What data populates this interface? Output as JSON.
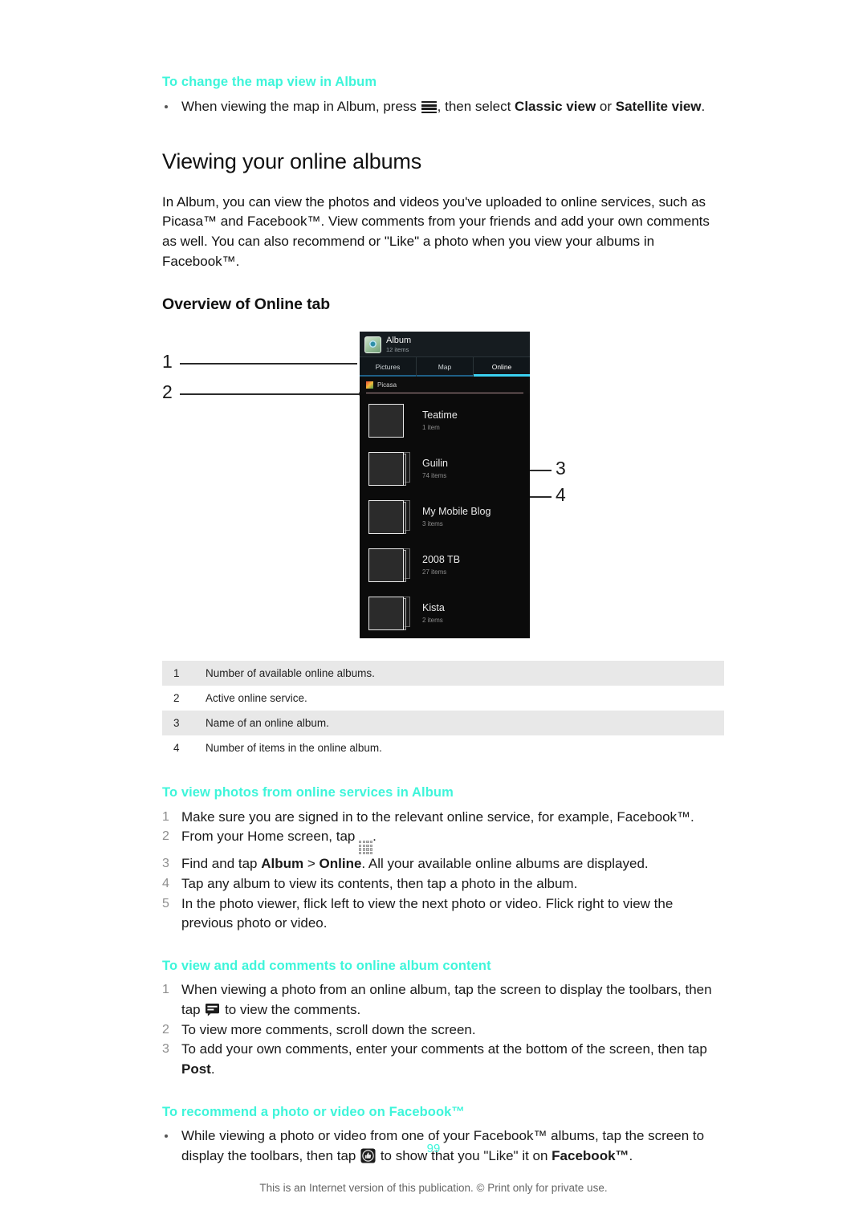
{
  "sections": {
    "change_map_view": {
      "heading": "To change the map view in Album",
      "bullet_pre": "When viewing the map in Album, press ",
      "bullet_mid": ", then select ",
      "bullet_bold1": "Classic view",
      "bullet_or": " or ",
      "bullet_bold2": "Satellite view",
      "bullet_end": "."
    },
    "viewing_online_albums": {
      "title": "Viewing your online albums",
      "paragraph": "In Album, you can view the photos and videos you've uploaded to online services, such as Picasa™ and Facebook™. View comments from your friends and add your own comments as well. You can also recommend or \"Like\" a photo when you view your albums in Facebook™."
    },
    "overview_online_tab": {
      "title": "Overview of Online tab"
    },
    "view_photos": {
      "heading": "To view photos from online services in Album",
      "steps": [
        {
          "pre": "Make sure you are signed in to the relevant online service, for example, Facebook™.",
          "icon": null,
          "post": ""
        },
        {
          "pre": "From your Home screen, tap ",
          "icon": "app-drawer-icon",
          "post": "."
        },
        {
          "pre": "Find and tap ",
          "bold1": "Album",
          "mid": " > ",
          "bold2": "Online",
          "post": ". All your available online albums are displayed."
        },
        {
          "pre": "Tap any album to view its contents, then tap a photo in the album.",
          "icon": null,
          "post": ""
        },
        {
          "pre": "In the photo viewer, flick left to view the next photo or video. Flick right to view the previous photo or video.",
          "icon": null,
          "post": ""
        }
      ]
    },
    "comments": {
      "heading": "To view and add comments to online album content",
      "step1_pre": "When viewing a photo from an online album, tap the screen to display the toolbars, then tap ",
      "step1_post": " to view the comments.",
      "step2": "To view more comments, scroll down the screen.",
      "step3_pre": "To add your own comments, enter your comments at the bottom of the screen, then tap ",
      "step3_bold": "Post",
      "step3_post": "."
    },
    "recommend": {
      "heading": "To recommend a photo or video on Facebook™",
      "bullet_pre": "While viewing a photo or video from one of your Facebook™ albums, tap the screen to display the toolbars, then tap ",
      "bullet_mid": " to show that you \"Like\" it on ",
      "bullet_bold": "Facebook™",
      "bullet_end": "."
    }
  },
  "phone": {
    "app_name": "Album",
    "app_count": "12 items",
    "tabs": [
      {
        "label": "Pictures",
        "active": false
      },
      {
        "label": "Map",
        "active": false
      },
      {
        "label": "Online",
        "active": true
      }
    ],
    "service": "Picasa",
    "albums": [
      {
        "name": "Teatime",
        "count": "1 item"
      },
      {
        "name": "Guilin",
        "count": "74 items"
      },
      {
        "name": "My Mobile Blog",
        "count": "3 items"
      },
      {
        "name": "2008 TB",
        "count": "27 items"
      },
      {
        "name": "Kista",
        "count": "2 items"
      }
    ]
  },
  "callouts": {
    "n1": "1",
    "n2": "2",
    "n3": "3",
    "n4": "4"
  },
  "legend": {
    "rows": [
      {
        "num": "1",
        "text": "Number of available online albums."
      },
      {
        "num": "2",
        "text": "Active online service."
      },
      {
        "num": "3",
        "text": "Name of an online album."
      },
      {
        "num": "4",
        "text": "Number of items in the online album."
      }
    ]
  },
  "footer": {
    "page_number": "99",
    "note": "This is an Internet version of this publication. © Print only for private use."
  },
  "colors": {
    "heading_accent": "#3ef5da",
    "tab_active_underline": "#3ad0f0",
    "tab_underline": "#1f5f86",
    "legend_shade": "#e8e8e8"
  }
}
